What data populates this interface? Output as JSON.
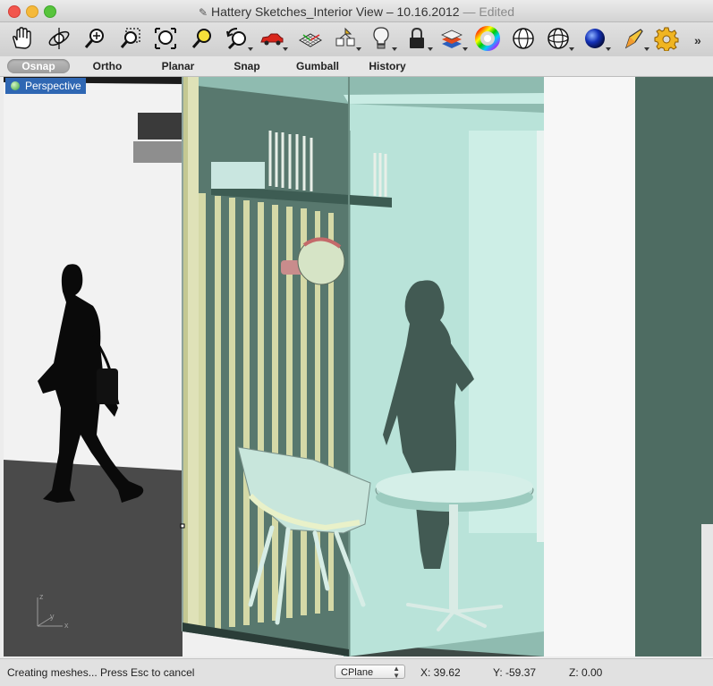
{
  "window": {
    "title": "Hattery Sketches_Interior View – 10.16.2012",
    "edited": "— Edited"
  },
  "toolbar": {
    "tools": [
      {
        "name": "pan-hand-icon"
      },
      {
        "name": "rotate-view-icon"
      },
      {
        "name": "zoom-icon"
      },
      {
        "name": "zoom-window-icon"
      },
      {
        "name": "zoom-extents-icon"
      },
      {
        "name": "zoom-selected-icon"
      },
      {
        "name": "undo-view-icon"
      },
      {
        "name": "car-icon"
      },
      {
        "name": "grid-plane-icon"
      },
      {
        "name": "named-cplane-icon"
      },
      {
        "name": "lightbulb-icon"
      },
      {
        "name": "lock-icon"
      },
      {
        "name": "layers-icon"
      },
      {
        "name": "color-wheel-icon"
      },
      {
        "name": "wireframe-sphere-icon"
      },
      {
        "name": "shaded-sphere-icon"
      },
      {
        "name": "rendered-sphere-icon"
      },
      {
        "name": "pen-tool-icon"
      },
      {
        "name": "gear-settings-icon"
      }
    ],
    "more_label": "»"
  },
  "modes": [
    "Osnap",
    "Ortho",
    "Planar",
    "Snap",
    "Gumball",
    "History"
  ],
  "active_mode": "Osnap",
  "viewport": {
    "label": "Perspective",
    "axes": {
      "z": "z",
      "y": "y",
      "x": "x"
    }
  },
  "status": {
    "message": "Creating meshes... Press Esc to cancel",
    "cplane": "CPlane",
    "x": "X: 39.62",
    "y": "Y: -59.37",
    "z": "Z: 0.00"
  },
  "colors": {
    "accent": "#2f67b3",
    "glass": "#a8ddd2",
    "dark_wall": "#4d6b62",
    "slats": "#d8dcae"
  }
}
